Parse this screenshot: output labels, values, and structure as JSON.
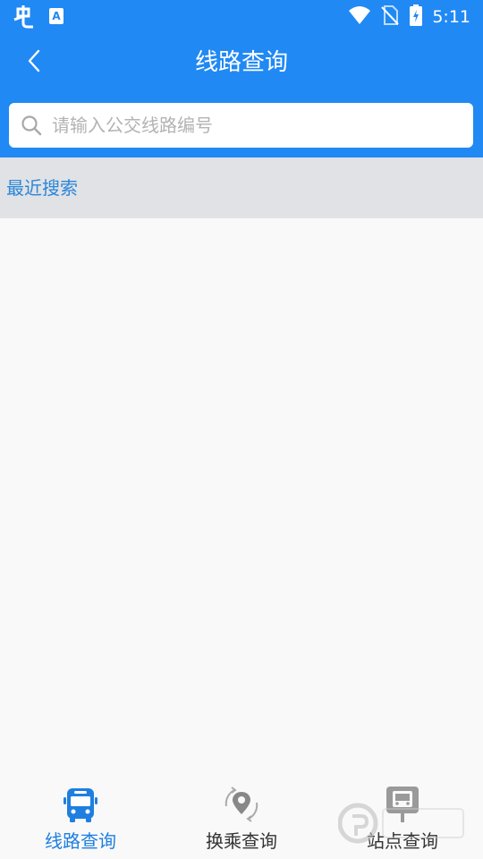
{
  "status_bar": {
    "time": "5:11",
    "left_icons": [
      "bug-app-icon",
      "font-a-icon"
    ],
    "right_icons": [
      "wifi-icon",
      "no-sim-icon",
      "battery-charging-icon"
    ]
  },
  "header": {
    "title": "线路查询",
    "back_icon": "chevron-left-icon",
    "background_color": "#2089f4"
  },
  "search": {
    "placeholder": "请输入公交线路编号",
    "value": "",
    "icon": "search-icon"
  },
  "recent": {
    "label": "最近搜索"
  },
  "bottom_nav": {
    "items": [
      {
        "label": "线路查询",
        "icon": "bus-icon",
        "active": true
      },
      {
        "label": "换乘查询",
        "icon": "transfer-location-icon",
        "active": false
      },
      {
        "label": "站点查询",
        "icon": "bus-stop-icon",
        "active": false
      }
    ],
    "active_color": "#1e7fe0"
  }
}
